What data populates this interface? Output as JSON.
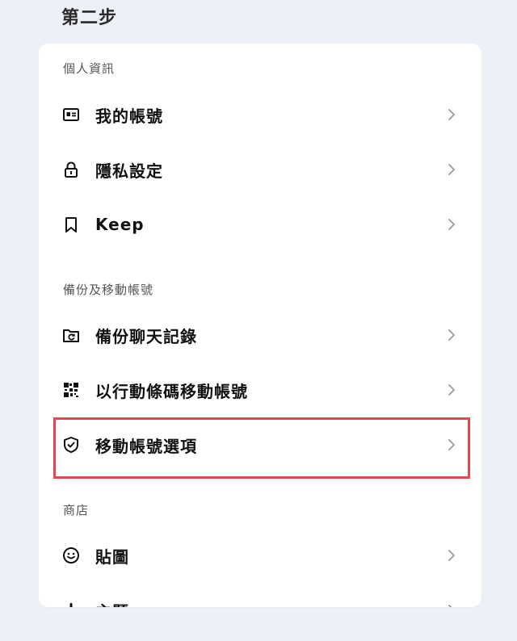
{
  "step_title": "第二步",
  "sections": {
    "personal": {
      "header": "個人資訊",
      "items": [
        {
          "label": "我的帳號",
          "icon": "id-card-icon"
        },
        {
          "label": "隱私設定",
          "icon": "lock-icon"
        },
        {
          "label": "Keep",
          "icon": "bookmark-icon"
        }
      ]
    },
    "backup": {
      "header": "備份及移動帳號",
      "items": [
        {
          "label": "備份聊天記錄",
          "icon": "backup-icon"
        },
        {
          "label": "以行動條碼移動帳號",
          "icon": "qr-code-icon"
        },
        {
          "label": "移動帳號選項",
          "icon": "shield-check-icon"
        }
      ]
    },
    "store": {
      "header": "商店",
      "items": [
        {
          "label": "貼圖",
          "icon": "smiley-icon"
        },
        {
          "label": "主題",
          "icon": "brush-icon"
        }
      ]
    }
  },
  "colors": {
    "background": "#eef0f8",
    "card": "#ffffff",
    "highlight_border": "#e5484d",
    "text": "#111111",
    "chevron": "#9a9a9a"
  }
}
